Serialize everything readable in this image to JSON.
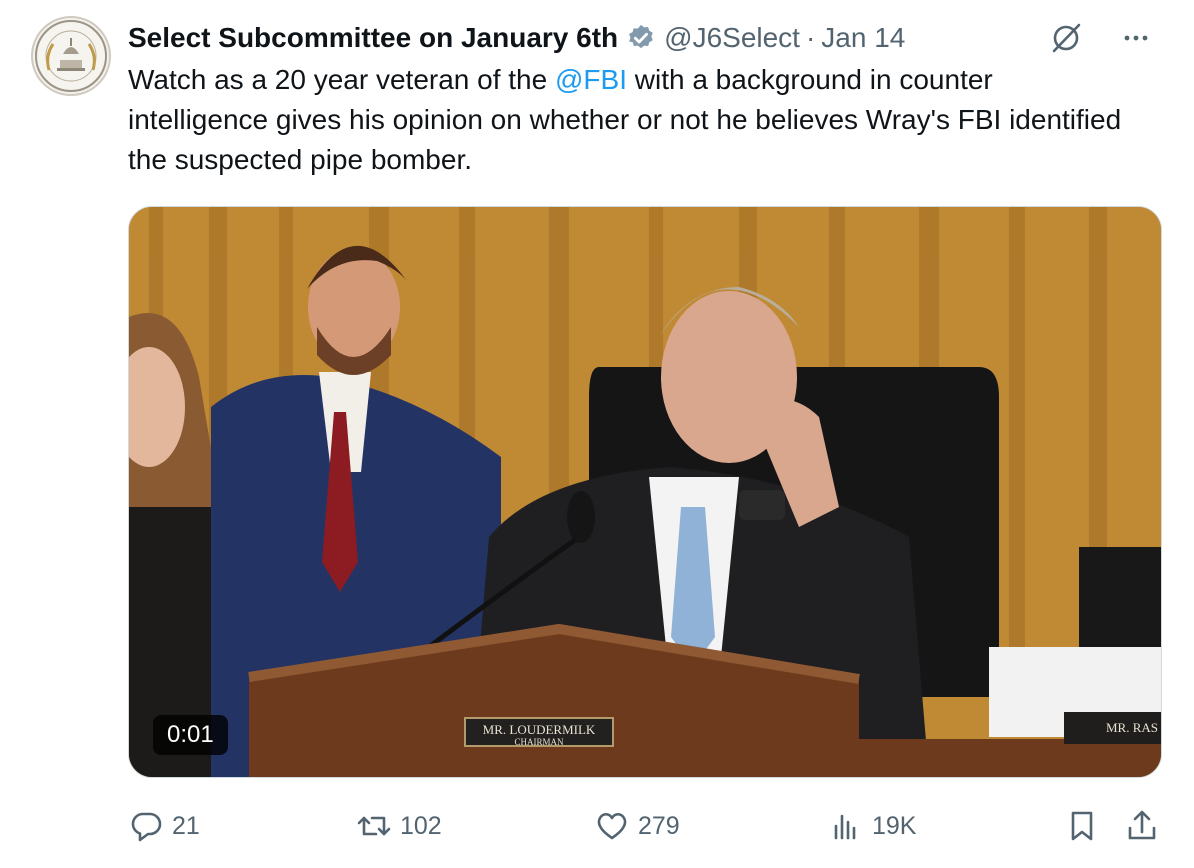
{
  "author": {
    "display_name": "Select Subcommittee on January 6th",
    "handle": "@J6Select",
    "separator": "·",
    "date": "Jan 14",
    "avatar_icon": "capitol-seal-icon",
    "verified_icon": "verified-badge-icon",
    "verified_color": "#829aab"
  },
  "tweet": {
    "text_before": "Watch as a 20 year veteran of the ",
    "mention": "@FBI",
    "text_after": " with a background in counter intelligence gives his opinion on whether or not he believes Wray's FBI identified the suspected pipe bomber."
  },
  "media": {
    "timestamp": "0:01",
    "nameplate_name": "MR. LOUDERMILK",
    "nameplate_title": "CHAIRMAN",
    "nameplate2_name": "MR. RAS"
  },
  "actions": {
    "replies": "21",
    "reposts": "102",
    "likes": "279",
    "views": "19K"
  },
  "colors": {
    "text": "#0f1419",
    "muted": "#536471",
    "link": "#1d9bf0"
  }
}
